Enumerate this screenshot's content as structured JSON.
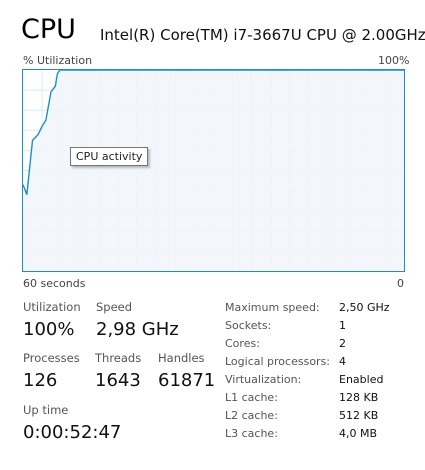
{
  "header": {
    "title": "CPU",
    "cpu_name": "Intel(R) Core(TM) i7-3667U CPU @ 2.00GHz"
  },
  "graph": {
    "y_label": "% Utilization",
    "y_max_label": "100%",
    "x_label": "60 seconds",
    "x_min_label": "0",
    "tooltip": "CPU activity",
    "line_color": "#1d8ec7",
    "grid_color": "#d9eaf4",
    "fill_color": "#f1f6fb"
  },
  "chart_data": {
    "type": "area",
    "title": "",
    "xlabel": "60 seconds",
    "ylabel": "% Utilization",
    "xlim": [
      60,
      0
    ],
    "ylim": [
      0,
      100
    ],
    "grid": true,
    "x": [
      60,
      59.4,
      58.5,
      57.6,
      57,
      56.4,
      55.6,
      54.9,
      54.6,
      54.2,
      53.5,
      0
    ],
    "values": [
      43,
      38,
      65,
      68,
      72,
      75,
      89,
      92,
      98,
      100,
      100,
      100
    ]
  },
  "stats": {
    "utilization": {
      "label": "Utilization",
      "value": "100%"
    },
    "speed": {
      "label": "Speed",
      "value": "2,98 GHz"
    },
    "processes": {
      "label": "Processes",
      "value": "126"
    },
    "threads": {
      "label": "Threads",
      "value": "1643"
    },
    "handles": {
      "label": "Handles",
      "value": "61871"
    },
    "uptime": {
      "label": "Up time",
      "value": "0:00:52:47"
    }
  },
  "specs": [
    {
      "label": "Maximum speed:",
      "value": "2,50 GHz"
    },
    {
      "label": "Sockets:",
      "value": "1"
    },
    {
      "label": "Cores:",
      "value": "2"
    },
    {
      "label": "Logical processors:",
      "value": "4"
    },
    {
      "label": "Virtualization:",
      "value": "Enabled"
    },
    {
      "label": "L1 cache:",
      "value": "128 KB"
    },
    {
      "label": "L2 cache:",
      "value": "512 KB"
    },
    {
      "label": "L3 cache:",
      "value": "4,0 MB"
    }
  ]
}
